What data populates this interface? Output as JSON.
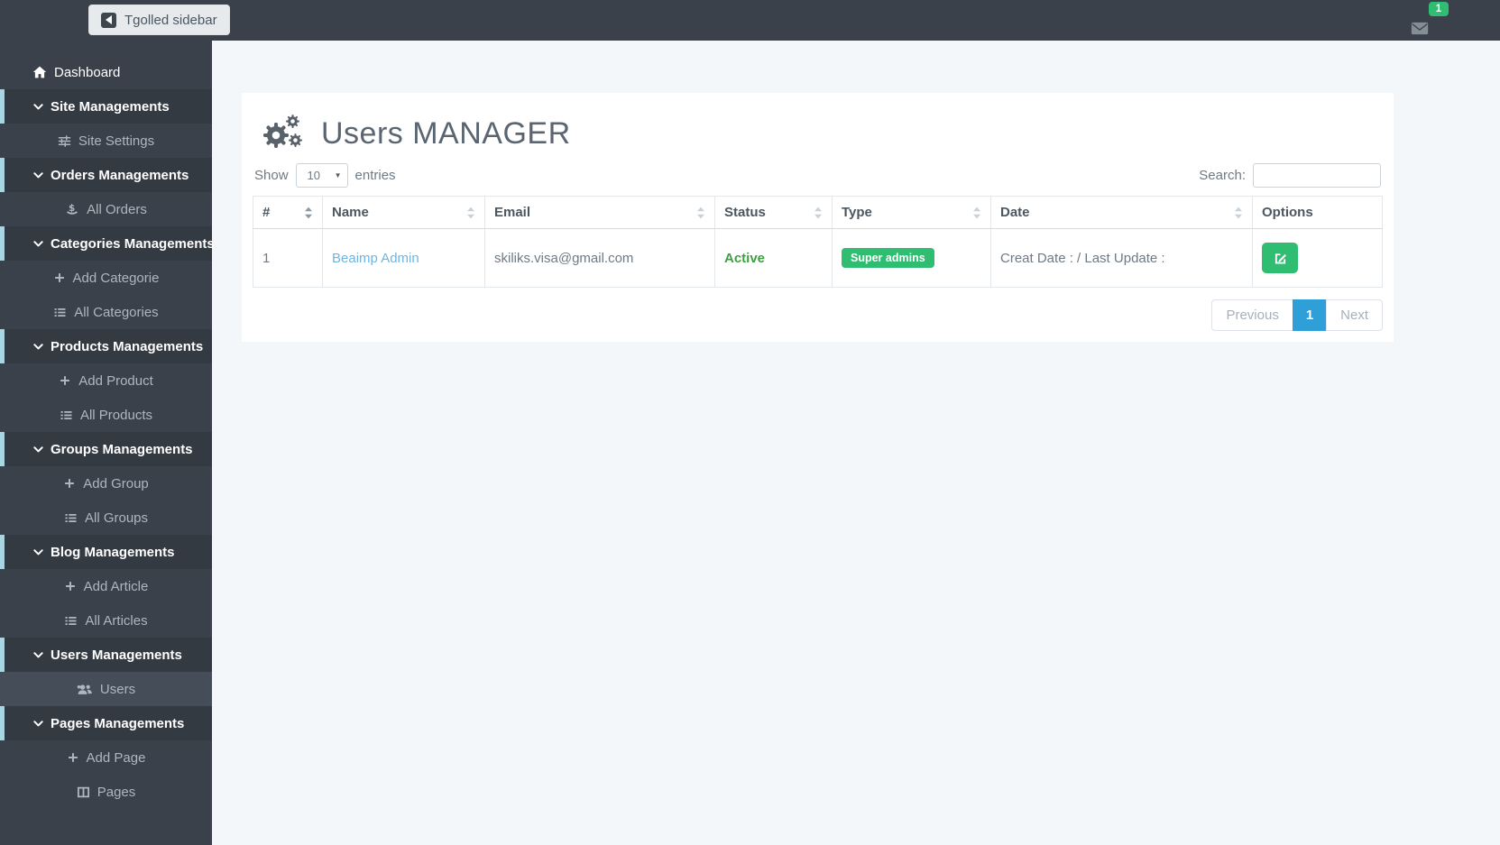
{
  "topbar": {
    "toggle_label": "Tgolled sidebar",
    "mail_badge_count": "1"
  },
  "sidebar": {
    "items": [
      {
        "label": "Dashboard",
        "icon": "home",
        "type": "link"
      },
      {
        "label": "Site Managements",
        "icon": "chevron-down",
        "type": "parent"
      },
      {
        "label": "Site Settings",
        "icon": "sliders",
        "type": "sub"
      },
      {
        "label": "Orders Managements",
        "icon": "chevron-down",
        "type": "parent"
      },
      {
        "label": "All Orders",
        "icon": "money",
        "type": "sub"
      },
      {
        "label": "Categories Managements",
        "icon": "chevron-down",
        "type": "parent"
      },
      {
        "label": "Add Categorie",
        "icon": "plus",
        "type": "sub"
      },
      {
        "label": "All Categories",
        "icon": "list",
        "type": "sub"
      },
      {
        "label": "Products Managements",
        "icon": "chevron-down",
        "type": "parent"
      },
      {
        "label": "Add Product",
        "icon": "plus",
        "type": "sub"
      },
      {
        "label": "All Products",
        "icon": "list",
        "type": "sub"
      },
      {
        "label": "Groups Managements",
        "icon": "chevron-down",
        "type": "parent"
      },
      {
        "label": "Add Group",
        "icon": "plus",
        "type": "sub"
      },
      {
        "label": "All Groups",
        "icon": "list",
        "type": "sub"
      },
      {
        "label": "Blog Managements",
        "icon": "chevron-down",
        "type": "parent"
      },
      {
        "label": "Add Article",
        "icon": "plus",
        "type": "sub"
      },
      {
        "label": "All Articles",
        "icon": "list",
        "type": "sub"
      },
      {
        "label": "Users Managements",
        "icon": "chevron-down",
        "type": "parent"
      },
      {
        "label": "Users",
        "icon": "users",
        "type": "sub",
        "active": true
      },
      {
        "label": "Pages Managements",
        "icon": "chevron-down",
        "type": "parent"
      },
      {
        "label": "Add Page",
        "icon": "plus",
        "type": "sub"
      },
      {
        "label": "Pages",
        "icon": "columns",
        "type": "sub"
      }
    ]
  },
  "main": {
    "title": "Users MANAGER",
    "length_control": {
      "show_label": "Show",
      "value": "10",
      "entries_label": "entries"
    },
    "search": {
      "label": "Search:",
      "value": ""
    },
    "table": {
      "columns": [
        "#",
        "Name",
        "Email",
        "Status",
        "Type",
        "Date",
        "Options"
      ],
      "rows": [
        {
          "index": "1",
          "name": "Beaimp Admin",
          "email": "skiliks.visa@gmail.com",
          "status": "Active",
          "type_badge": "Super admins",
          "date": "Creat Date : / Last Update :"
        }
      ]
    },
    "pagination": {
      "previous": "Previous",
      "page": "1",
      "next": "Next"
    }
  },
  "colors": {
    "topbar_bg": "#3a414a",
    "sidebar_bg": "#3a414a",
    "sidebar_parent_bg": "#333a42",
    "sidebar_accent": "#a9d6e3",
    "content_bg": "#f4f7fa",
    "link_blue": "#70b4e0",
    "status_green": "#3f9e42",
    "success_green": "#2ebd71",
    "pagination_active_blue": "#2f9fd7"
  }
}
